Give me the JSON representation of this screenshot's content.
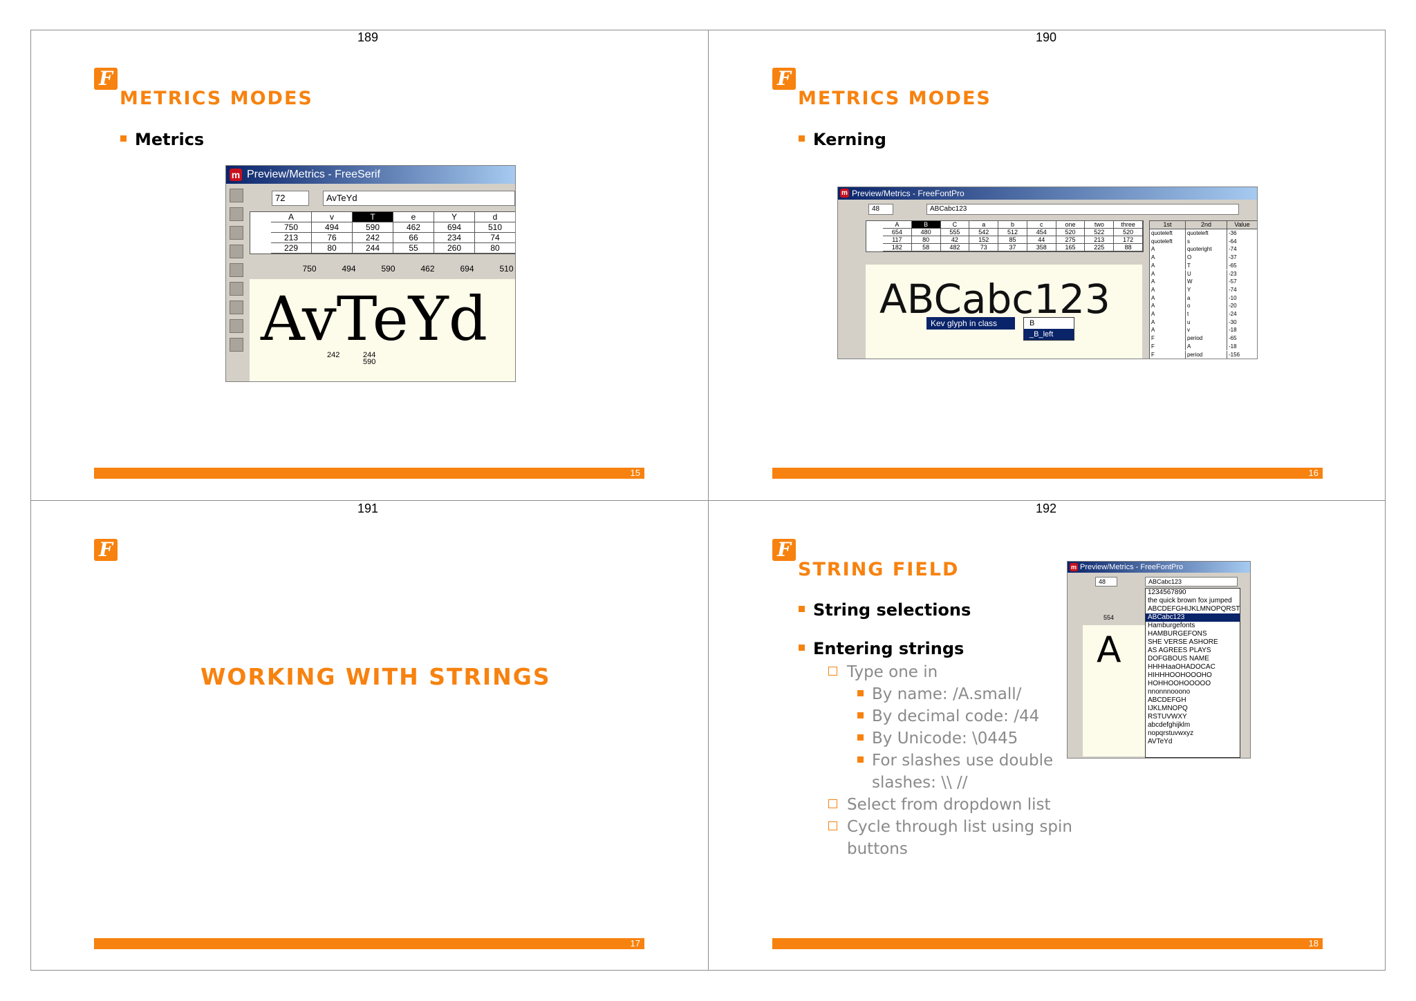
{
  "page_numbers": {
    "tl": "189",
    "tr": "190",
    "bl": "191",
    "br": "192"
  },
  "logo_glyph": "F",
  "slides": {
    "s15": {
      "title": "METRICS MODES",
      "bullet": "Metrics",
      "footer_num": "15",
      "window": {
        "title": "Preview/Metrics - FreeSerif",
        "size": "72",
        "text": "AvTeYd",
        "columns": [
          "A",
          "v",
          "T",
          "e",
          "Y",
          "d"
        ],
        "rows": [
          [
            "750",
            "494",
            "590",
            "462",
            "694",
            "510"
          ],
          [
            "213",
            "76",
            "242",
            "66",
            "234",
            "74"
          ],
          [
            "229",
            "80",
            "244",
            "55",
            "260",
            "80"
          ]
        ],
        "totals": [
          "750",
          "494",
          "590",
          "462",
          "694",
          "510"
        ],
        "glyph_text": "AvTeYd",
        "marker_left": "242",
        "marker_right_top": "244",
        "marker_right_bottom": "590"
      }
    },
    "s16": {
      "title": "METRICS MODES",
      "bullet": "Kerning",
      "footer_num": "16",
      "window": {
        "title": "Preview/Metrics - FreeFontPro",
        "size": "48",
        "text": "ABCabc123",
        "columns": [
          "A",
          "B",
          "C",
          "a",
          "b",
          "c",
          "one",
          "two",
          "three"
        ],
        "rows": [
          [
            "654",
            "480",
            "555",
            "542",
            "512",
            "454",
            "520",
            "522",
            "520"
          ],
          [
            "117",
            "80",
            "42",
            "152",
            "85",
            "44",
            "275",
            "213",
            "172"
          ],
          [
            "182",
            "58",
            "482",
            "73",
            "37",
            "358",
            "165",
            "225",
            "88"
          ]
        ],
        "kern_header": [
          "1st",
          "2nd",
          "Value"
        ],
        "kern_rows": [
          [
            "quoteleft",
            "quoteleft",
            "-36"
          ],
          [
            "quoteleft",
            "s",
            "-64"
          ],
          [
            "A",
            "quoteright",
            "-74"
          ],
          [
            "A",
            "O",
            "-37"
          ],
          [
            "A",
            "T",
            "-65"
          ],
          [
            "A",
            "U",
            "-23"
          ],
          [
            "A",
            "W",
            "-57"
          ],
          [
            "A",
            "Y",
            "-74"
          ],
          [
            "A",
            "a",
            "-10"
          ],
          [
            "A",
            "o",
            "-20"
          ],
          [
            "A",
            "t",
            "-24"
          ],
          [
            "A",
            "u",
            "-30"
          ],
          [
            "A",
            "v",
            "-18"
          ],
          [
            "F",
            "period",
            "-65"
          ],
          [
            "F",
            "A",
            "-18"
          ],
          [
            "F",
            "period",
            "-156"
          ]
        ],
        "glyph_text": "ABCabc123",
        "menu_item": "Kev glyph in class",
        "submenu": [
          "B",
          "_B_left"
        ]
      }
    },
    "s17": {
      "title": "WORKING WITH STRINGS",
      "footer_num": "17"
    },
    "s18": {
      "title": "STRING FIELD",
      "footer_num": "18",
      "bullets": [
        "String selections",
        "Entering strings"
      ],
      "sub_items": [
        {
          "level": 1,
          "text": "Type one in"
        },
        {
          "level": 2,
          "text": "By name: /A.small/"
        },
        {
          "level": 2,
          "text": "By decimal code: /44"
        },
        {
          "level": 2,
          "text": "By Unicode: \\0445"
        },
        {
          "level": 2,
          "text": "For slashes use double"
        },
        {
          "level": 2,
          "text": "slashes: \\\\ //",
          "continuation": true
        },
        {
          "level": 1,
          "text": "Select from dropdown list"
        },
        {
          "level": 1,
          "text": "Cycle through list using spin"
        },
        {
          "level": 1,
          "text": "buttons",
          "continuation": true
        }
      ],
      "window": {
        "title": "Preview/Metrics - FreeFontPro",
        "size": "48",
        "text": "ABCabc123",
        "col_value": "554",
        "glyph": "A",
        "dropdown": [
          "1234567890",
          "the quick brown fox jumped",
          "ABCDEFGHIJKLMNOPQRST",
          "ABCabc123",
          "Hamburgefonts",
          "HAMBURGEFONS",
          "SHE VERSE ASHORE",
          "AS AGREES PLAYS",
          "DOFGBOUS NAME",
          "HHHHaaOHADOCAC",
          "HIHHHOOHOOOHO",
          "HOHHOOHOOOOO",
          "nnonnnooono",
          "ABCDEFGH",
          "IJKLMNOPQ",
          "RSTUVWXY",
          "abcdefghijklm",
          "nopqrstuvwxyz",
          "AVTeYd"
        ],
        "selected_index": 3
      }
    }
  }
}
